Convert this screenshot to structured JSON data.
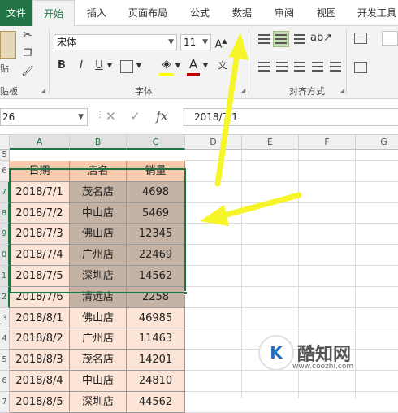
{
  "tabs": [
    "文件",
    "开始",
    "插入",
    "页面布局",
    "公式",
    "数据",
    "审阅",
    "视图",
    "开发工具"
  ],
  "ribbon": {
    "clipboard_label": "贴板",
    "font_group_label": "字体",
    "align_group_label": "对齐方式",
    "font_name": "宋体",
    "font_size": "11",
    "bold": "B",
    "italic": "I",
    "underline": "U",
    "grow_font": "A",
    "font_color_letter": "A",
    "font_color": "#c00000",
    "fill_color": "#ffff00"
  },
  "formula_bar": {
    "name_box": "26",
    "cancel": "✕",
    "enter": "✓",
    "fx": "fx",
    "value": "2018/7/1"
  },
  "columns": [
    "A",
    "B",
    "C",
    "D",
    "E",
    "F",
    "G"
  ],
  "rows": [
    "5",
    "6",
    "7",
    "8",
    "9",
    "0",
    "1",
    "2",
    "3",
    "4",
    "5",
    "6",
    "7"
  ],
  "table": {
    "headers": [
      "日期",
      "店名",
      "销量"
    ],
    "rows": [
      [
        "2018/7/1",
        "茂名店",
        "4698"
      ],
      [
        "2018/7/2",
        "中山店",
        "5469"
      ],
      [
        "2018/7/3",
        "佛山店",
        "12345"
      ],
      [
        "2018/7/4",
        "广州店",
        "22469"
      ],
      [
        "2018/7/5",
        "深圳店",
        "14562"
      ],
      [
        "2018/7/6",
        "清远店",
        "2258"
      ],
      [
        "2018/8/1",
        "佛山店",
        "46985"
      ],
      [
        "2018/8/2",
        "广州店",
        "11463"
      ],
      [
        "2018/8/3",
        "茂名店",
        "14201"
      ],
      [
        "2018/8/4",
        "中山店",
        "24810"
      ],
      [
        "2018/8/5",
        "深圳店",
        "44562"
      ]
    ]
  },
  "colors": {
    "header_fill": "#f8cbad",
    "selected_fill": "#c4b3a5",
    "data_fill": "#fce4d6",
    "accent": "#217346",
    "arrow": "#f5f52a"
  },
  "watermark": {
    "brand": "酷知网",
    "url": "www.coozhi.com"
  }
}
